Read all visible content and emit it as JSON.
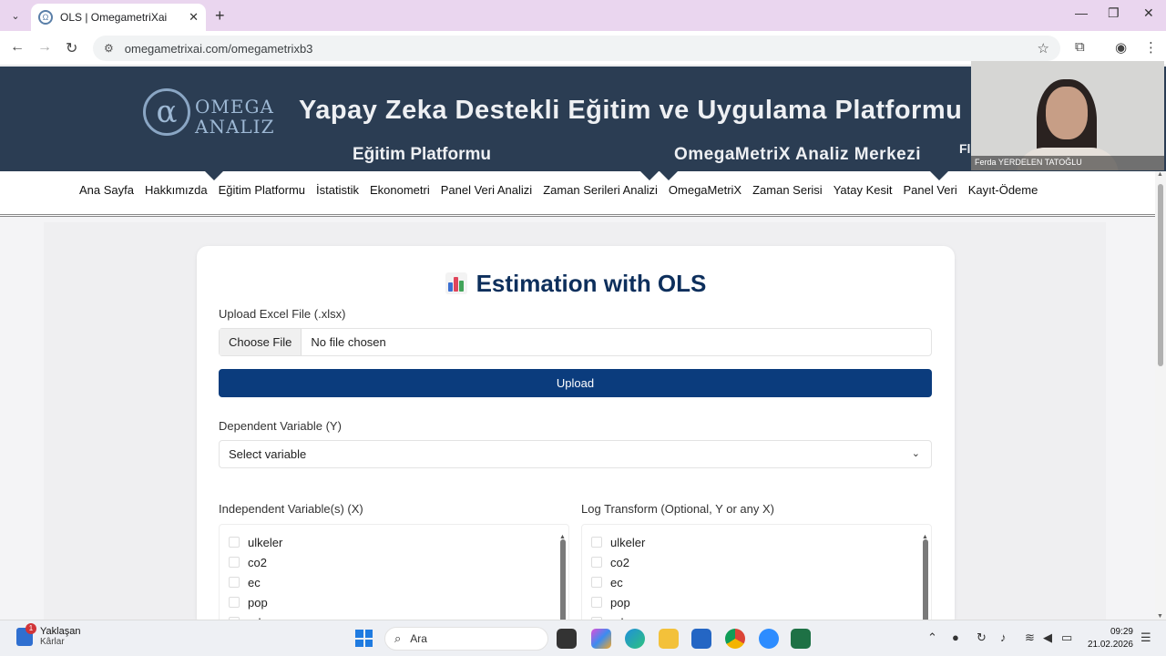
{
  "browser": {
    "tab_title": "OLS | OmegametriXai",
    "new_tab_glyph": "+",
    "close_glyph": "✕",
    "url": "omegametrixai.com/omegametrixb3",
    "nav": {
      "back": "←",
      "forward": "→",
      "reload": "↻"
    },
    "window": {
      "minimize": "—",
      "restore": "❐",
      "close": "✕"
    }
  },
  "header": {
    "logo_symbol": "α",
    "logo_line1": "OMEGA",
    "logo_line2": "ANALIZ",
    "title": "Yapay Zeka Destekli Eğitim ve Uygulama Platformu",
    "subtitle_left": "Eğitim Platformu",
    "subtitle_right": "OmegaMetriX Analiz Merkezi",
    "subtitle_clip": "Fl",
    "bg_color": "#2b3d53"
  },
  "nav_menu": [
    "Ana Sayfa",
    "Hakkımızda",
    "Eğitim Platformu",
    "İstatistik",
    "Ekonometri",
    "Panel Veri Analizi",
    "Zaman Serileri Analizi",
    "OmegaMetriX",
    "Zaman Serisi",
    "Yatay Kesit",
    "Panel Veri",
    "Kayıt-Ödeme"
  ],
  "webcam": {
    "name": "Ferda YERDELEN TATOĞLU"
  },
  "form": {
    "title": "Estimation with OLS",
    "title_icon": "bar-chart-icon",
    "upload_label": "Upload Excel File (.xlsx)",
    "choose_file": "Choose File",
    "no_file": "No file chosen",
    "upload_button": "Upload",
    "dependent_label": "Dependent Variable (Y)",
    "dependent_value": "Select variable",
    "independent_label": "Independent Variable(s) (X)",
    "log_label": "Log Transform (Optional, Y or any X)",
    "variables": [
      "ulkeler",
      "co2",
      "ec",
      "pop",
      "gdp"
    ],
    "accent_color": "#0b3c7d"
  },
  "taskbar": {
    "news_title": "Yaklaşan",
    "news_sub": "Kârlar",
    "news_badge": "1",
    "search_placeholder": "Ara",
    "time": "09:29",
    "date": "21.02.2026"
  }
}
